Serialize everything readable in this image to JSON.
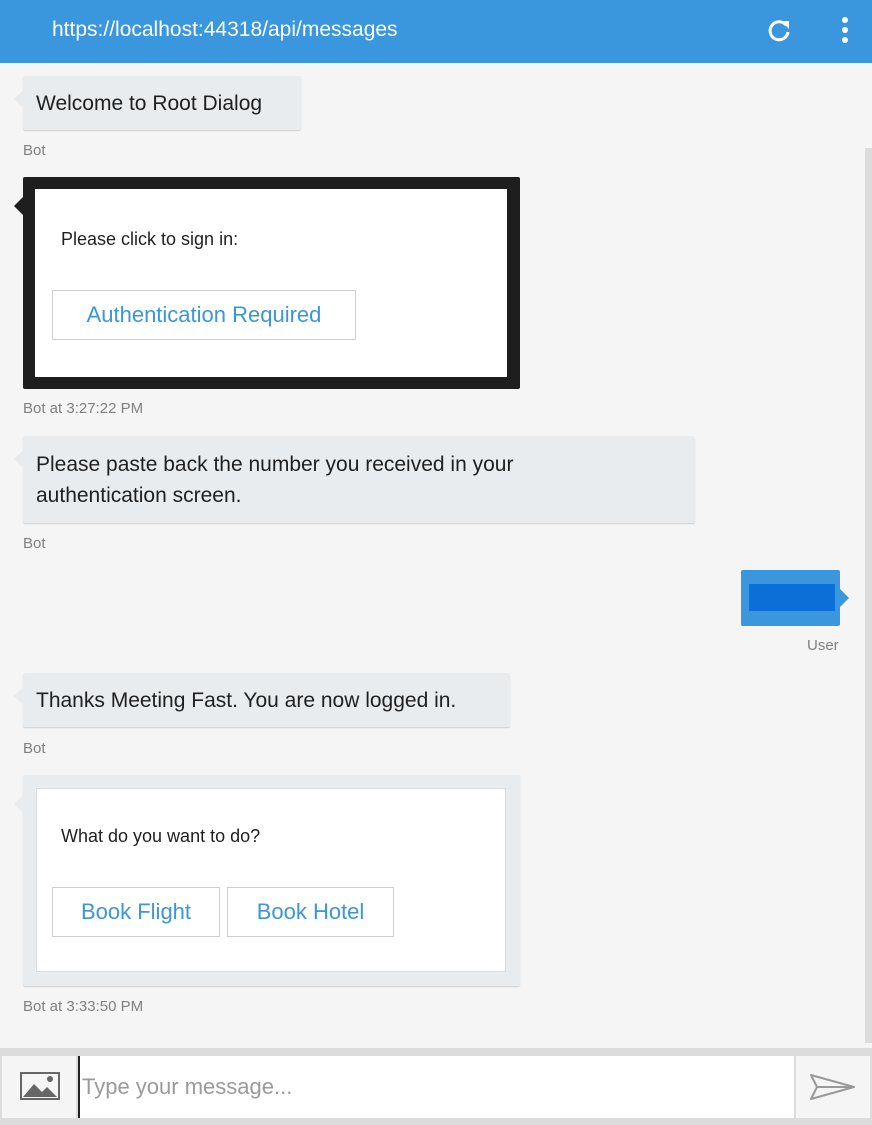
{
  "header": {
    "url": "https://localhost:44318/api/messages",
    "refresh_icon": "refresh-icon",
    "menu_icon": "more-vertical-icon",
    "color": "#3a96dd"
  },
  "messages": [
    {
      "from": "Bot",
      "text": "Welcome to Root Dialog",
      "meta": "Bot"
    },
    {
      "from": "Bot",
      "card": {
        "text": "Please click to sign in:",
        "buttons": [
          "Authentication Required"
        ]
      },
      "meta": "Bot at 3:27:22 PM"
    },
    {
      "from": "Bot",
      "lines": [
        "Please paste back the number you received in your",
        "authentication screen."
      ],
      "meta": "Bot"
    },
    {
      "from": "User",
      "text": "",
      "meta": "User"
    },
    {
      "from": "Bot",
      "text": "Thanks Meeting Fast. You are now logged in.",
      "meta": "Bot"
    },
    {
      "from": "Bot",
      "card": {
        "text": "What do you want to do?",
        "buttons": [
          "Book Flight",
          "Book Hotel"
        ]
      },
      "meta": "Bot at 3:33:50 PM"
    }
  ],
  "composer": {
    "placeholder": "Type your message...",
    "upload_icon": "image-upload-icon",
    "send_icon": "send-icon"
  }
}
